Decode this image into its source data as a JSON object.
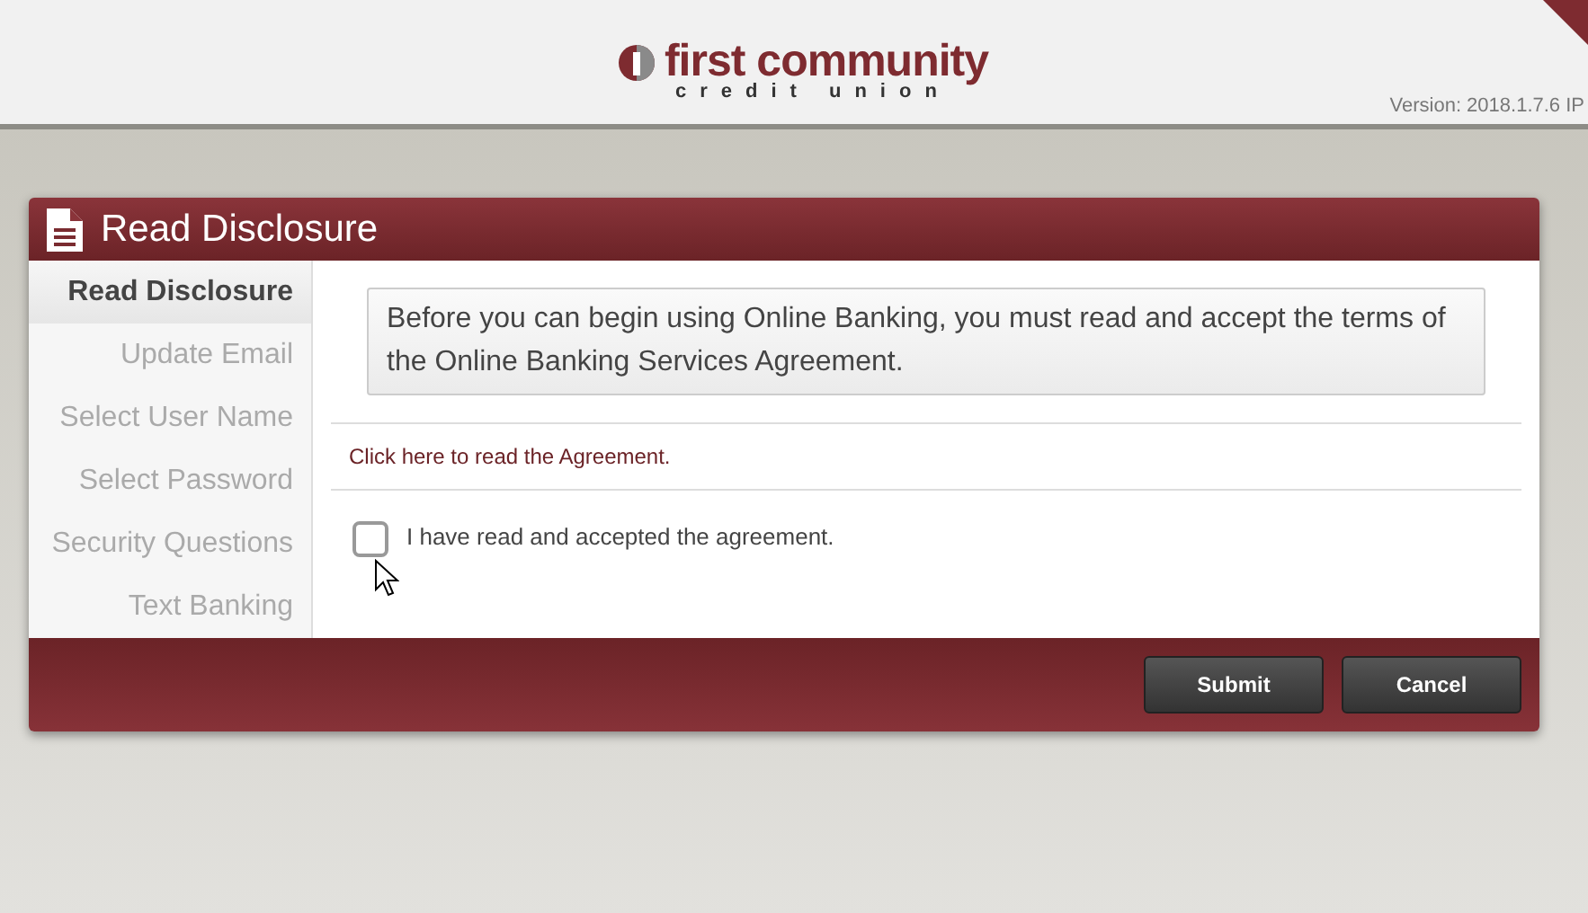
{
  "header": {
    "logo_name": "first community",
    "logo_tagline": "credit union",
    "version": "Version: 2018.1.7.6 IP"
  },
  "dialog": {
    "title": "Read Disclosure",
    "steps": [
      {
        "label": "Read Disclosure",
        "selected": true
      },
      {
        "label": "Update Email",
        "selected": false
      },
      {
        "label": "Select User Name",
        "selected": false
      },
      {
        "label": "Select Password",
        "selected": false
      },
      {
        "label": "Security Questions",
        "selected": false
      },
      {
        "label": "Text Banking",
        "selected": false
      }
    ],
    "notice": "Before you can begin using Online Banking, you must read and accept the terms of the Online Banking Services Agreement.",
    "agreement_link": "Click here to read the Agreement.",
    "accept": {
      "label": "I have read and accepted the agreement.",
      "checked": false
    },
    "buttons": [
      "Submit",
      "Cancel"
    ]
  }
}
